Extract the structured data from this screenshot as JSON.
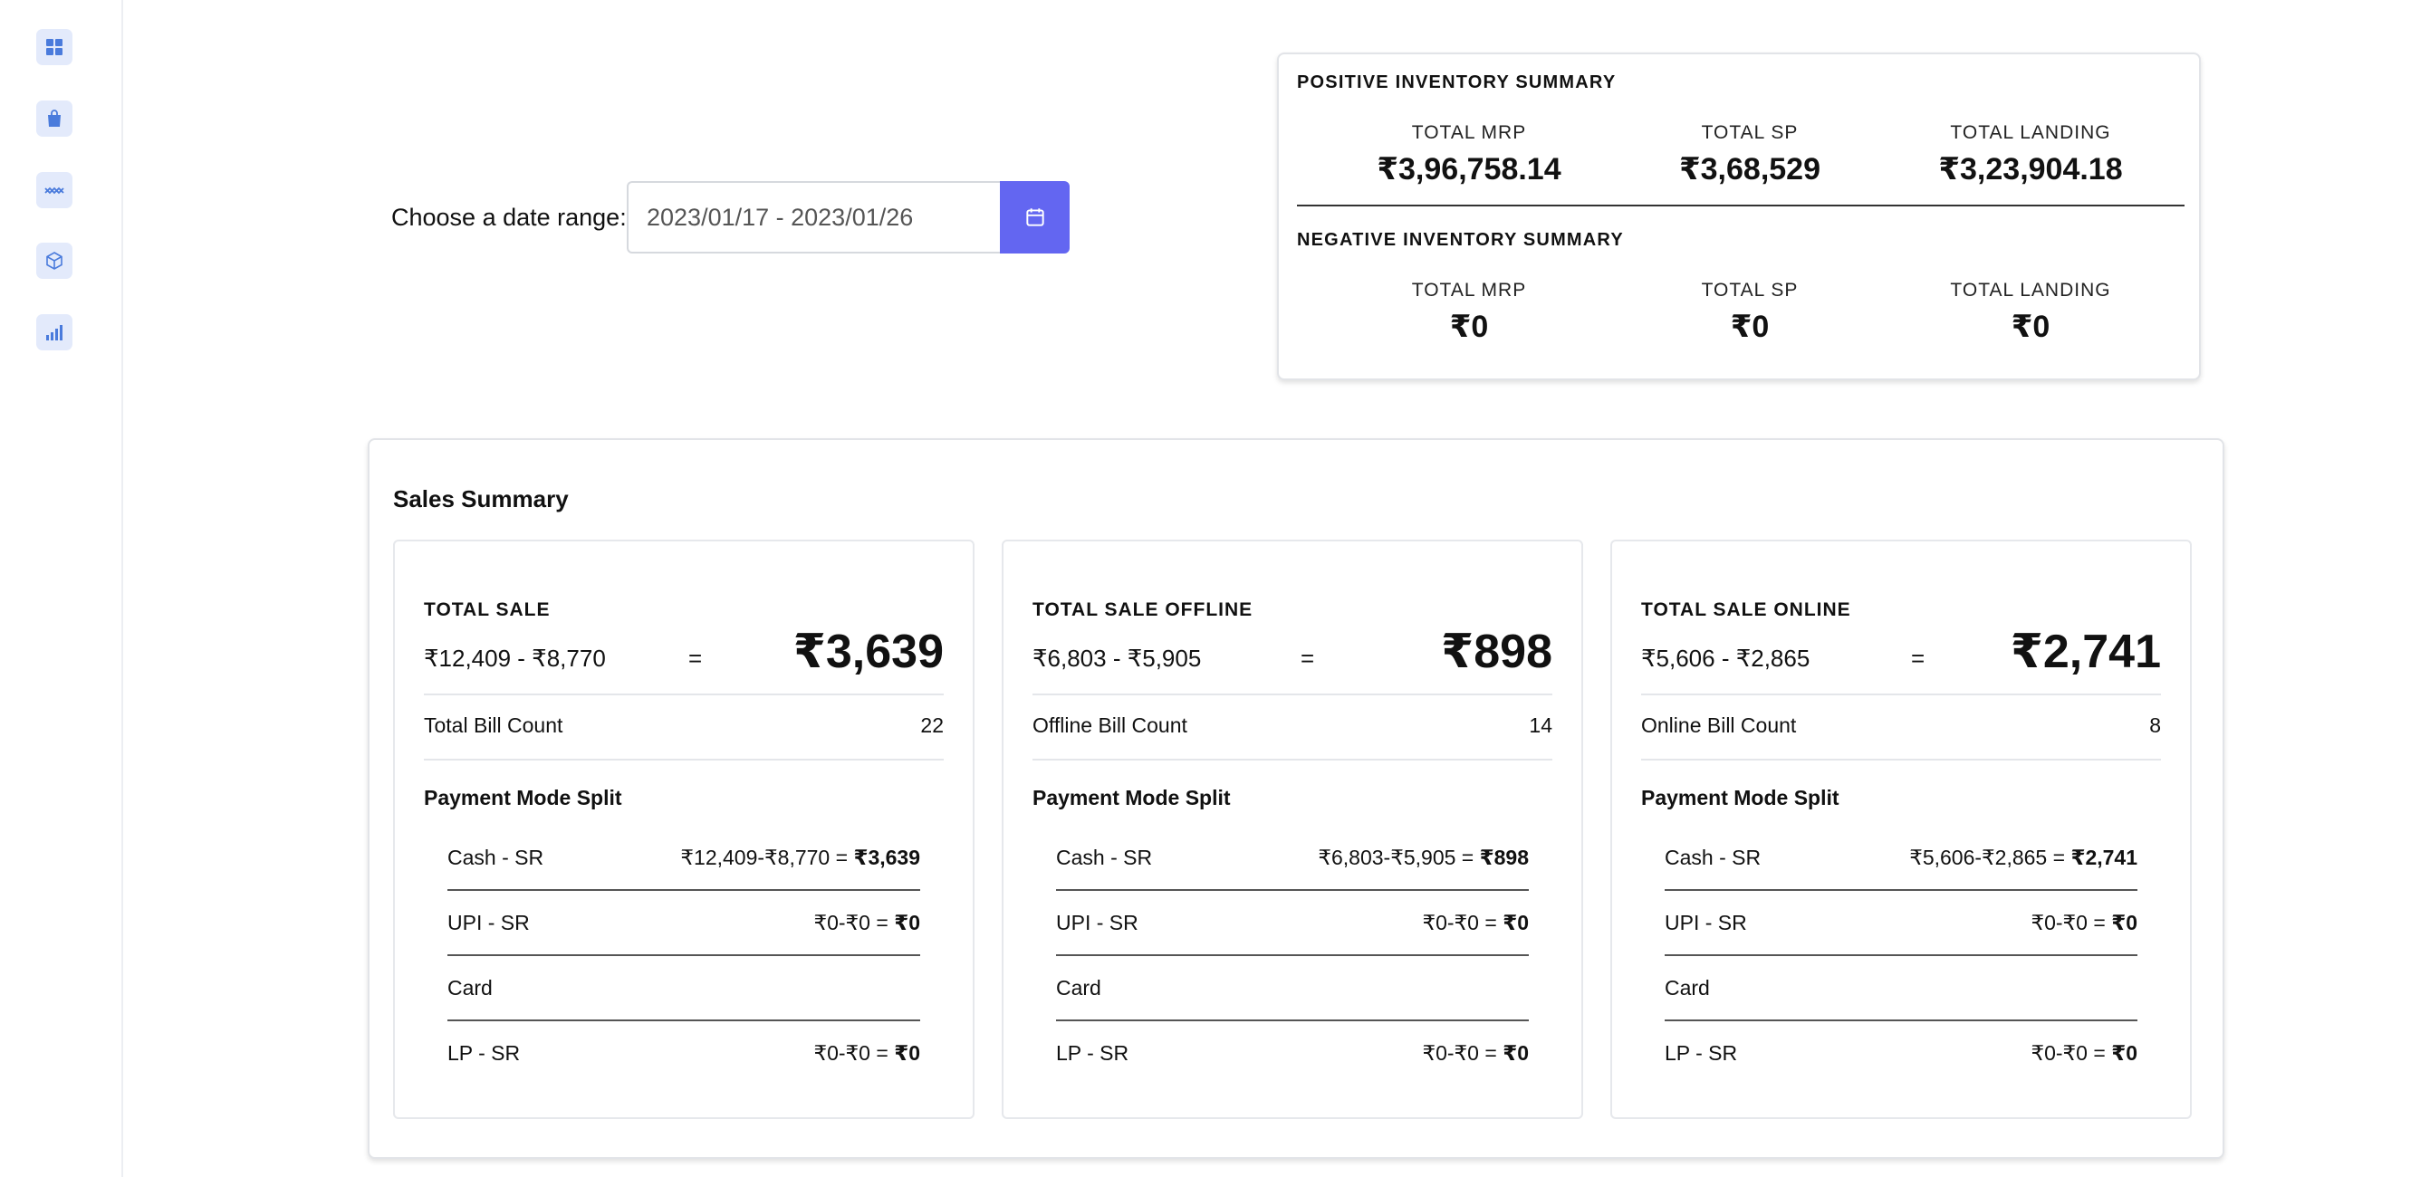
{
  "sidebar": {
    "items": [
      {
        "icon": "dashboard-icon"
      },
      {
        "icon": "shopping-bag-icon"
      },
      {
        "icon": "trend-icon"
      },
      {
        "icon": "cube-icon"
      },
      {
        "icon": "bar-chart-icon"
      }
    ]
  },
  "date_range": {
    "label": "Choose a date range:",
    "value": "2023/01/17 - 2023/01/26"
  },
  "inventory": {
    "positive": {
      "title": "POSITIVE INVENTORY SUMMARY",
      "mrp_label": "TOTAL MRP",
      "mrp_value": "₹3,96,758.14",
      "sp_label": "TOTAL SP",
      "sp_value": "₹3,68,529",
      "landing_label": "TOTAL LANDING",
      "landing_value": "₹3,23,904.18"
    },
    "negative": {
      "title": "NEGATIVE INVENTORY SUMMARY",
      "mrp_label": "TOTAL MRP",
      "mrp_value": "₹0",
      "sp_label": "TOTAL SP",
      "sp_value": "₹0",
      "landing_label": "TOTAL LANDING",
      "landing_value": "₹0"
    }
  },
  "sales": {
    "title": "Sales Summary",
    "cards": [
      {
        "heading": "TOTAL SALE",
        "formula": "₹12,409 - ₹8,770",
        "equals": "=",
        "total": "₹3,639",
        "bill_label": "Total Bill Count",
        "bill_value": "22",
        "payment_title": "Payment Mode Split",
        "payments": [
          {
            "name": "Cash - SR",
            "calc": "₹12,409-₹8,770 = ",
            "result": "₹3,639"
          },
          {
            "name": "UPI - SR",
            "calc": "₹0-₹0 = ",
            "result": "₹0"
          },
          {
            "name": "Card",
            "calc": "",
            "result": ""
          },
          {
            "name": "LP - SR",
            "calc": "₹0-₹0 = ",
            "result": "₹0"
          }
        ]
      },
      {
        "heading": "TOTAL SALE OFFLINE",
        "formula": "₹6,803 - ₹5,905",
        "equals": "=",
        "total": "₹898",
        "bill_label": "Offline Bill Count",
        "bill_value": "14",
        "payment_title": "Payment Mode Split",
        "payments": [
          {
            "name": "Cash - SR",
            "calc": "₹6,803-₹5,905 = ",
            "result": "₹898"
          },
          {
            "name": "UPI - SR",
            "calc": "₹0-₹0 = ",
            "result": "₹0"
          },
          {
            "name": "Card",
            "calc": "",
            "result": ""
          },
          {
            "name": "LP - SR",
            "calc": "₹0-₹0 = ",
            "result": "₹0"
          }
        ]
      },
      {
        "heading": "TOTAL SALE ONLINE",
        "formula": "₹5,606 - ₹2,865",
        "equals": "=",
        "total": "₹2,741",
        "bill_label": "Online Bill Count",
        "bill_value": "8",
        "payment_title": "Payment Mode Split",
        "payments": [
          {
            "name": "Cash - SR",
            "calc": "₹5,606-₹2,865 = ",
            "result": "₹2,741"
          },
          {
            "name": "UPI - SR",
            "calc": "₹0-₹0 = ",
            "result": "₹0"
          },
          {
            "name": "Card",
            "calc": "",
            "result": ""
          },
          {
            "name": "LP - SR",
            "calc": "₹0-₹0 = ",
            "result": "₹0"
          }
        ]
      }
    ]
  },
  "colors": {
    "accent": "#6366f1",
    "sidebar_icon": "#4a7bdc",
    "sidebar_icon_bg": "#e3eafb"
  }
}
